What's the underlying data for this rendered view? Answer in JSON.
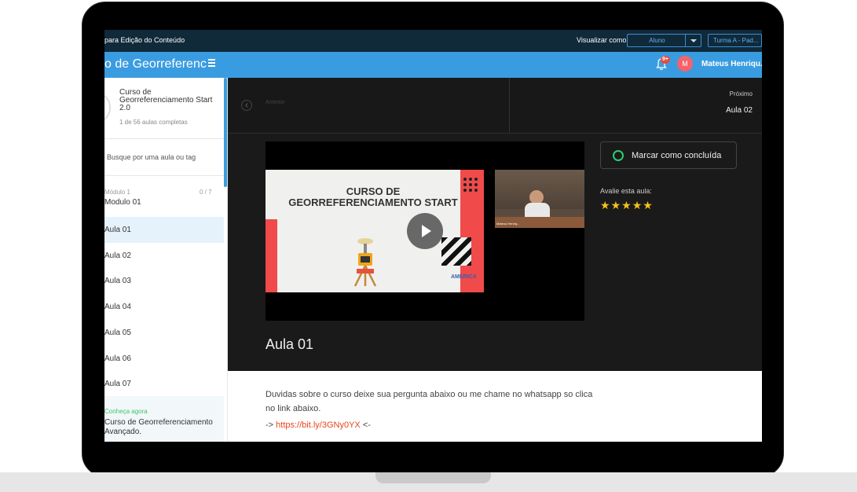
{
  "topbar": {
    "edit_text": "para Edição do Conteúdo",
    "view_as_label": "Visualizar como",
    "view_as_value": "Aluno",
    "class_value": "Turma A - Pad..."
  },
  "header": {
    "course_title": "o de Georreferenc",
    "notification_badge": "9+",
    "avatar_initial": "M",
    "user_name": "Mateus Henriqu..."
  },
  "sidebar": {
    "course_name": "Curso de Georreferenciamento Start 2.0",
    "course_progress": "1 de 56 aulas completas",
    "search_placeholder": "Busque por uma aula ou tag",
    "module_label": "Módulo 1",
    "module_count": "0 / 7",
    "module_name": "Modulo 01",
    "lessons": [
      "Aula 01",
      "Aula 02",
      "Aula 03",
      "Aula 04",
      "Aula 05",
      "Aula 06",
      "Aula 07"
    ],
    "promo_label": "Conheça agora",
    "promo_text": "Curso de Georreferenciamento Avançado."
  },
  "nav": {
    "prev_label": "Anterior",
    "next_label": "Próximo",
    "next_title": "Aula 02"
  },
  "video": {
    "slide_title": "CURSO DE GEORREFERENCIAMENTO START",
    "brand": "AMERICA",
    "webcam_caption": "Mateus Henriq..."
  },
  "lesson": {
    "title": "Aula 01",
    "complete_label": "Marcar como concluída",
    "rate_label": "Avalie esta aula:",
    "rating": 5,
    "description": "Duvidas sobre o curso deixe sua pergunta abaixo ou me chame no whatsapp so clica no link abaixo.",
    "link_prefix": "-> ",
    "link_url": "https://bit.ly/3GNy0YX",
    "link_suffix": " <-"
  },
  "colors": {
    "accent": "#3a9ce0",
    "topbar": "#102a3a",
    "complete_green": "#2ecc71",
    "star": "#f4c21b",
    "link": "#e8451c"
  }
}
